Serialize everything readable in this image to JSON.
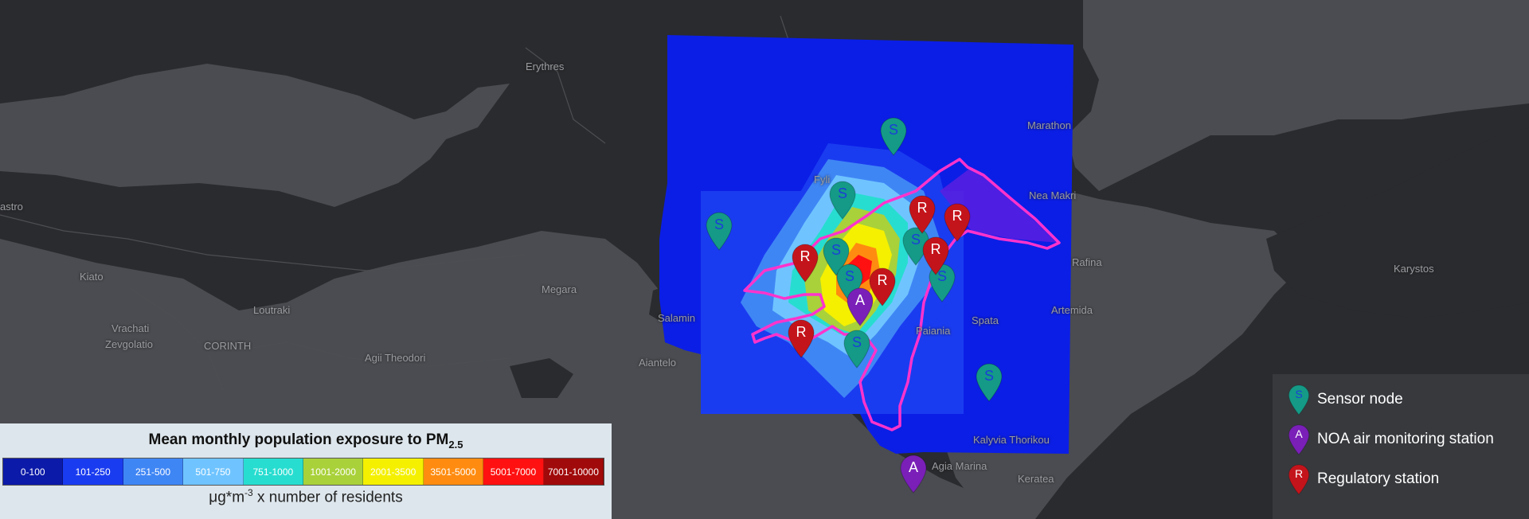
{
  "place_labels": [
    {
      "name": "Erythres"
    },
    {
      "name": "astro"
    },
    {
      "name": "Kiato"
    },
    {
      "name": "Loutraki"
    },
    {
      "name": "Vrachati"
    },
    {
      "name": "Zevgolatio"
    },
    {
      "name": "CORINTH"
    },
    {
      "name": "Agii Theodori"
    },
    {
      "name": "Megara"
    },
    {
      "name": "Fyli"
    },
    {
      "name": "Marathon"
    },
    {
      "name": "Nea Makri"
    },
    {
      "name": "Rafina"
    },
    {
      "name": "Karystos"
    },
    {
      "name": "Spata"
    },
    {
      "name": "Artemida"
    },
    {
      "name": "Paiania"
    },
    {
      "name": "Salamin"
    },
    {
      "name": "Aiantelo"
    },
    {
      "name": "Kalyvia Thorikou"
    },
    {
      "name": "Agia Marina"
    },
    {
      "name": "Keratea"
    }
  ],
  "markers": [
    {
      "type": "sensor",
      "letter": "S"
    },
    {
      "type": "sensor",
      "letter": "S"
    },
    {
      "type": "sensor",
      "letter": "S"
    },
    {
      "type": "sensor",
      "letter": "S"
    },
    {
      "type": "sensor",
      "letter": "S"
    },
    {
      "type": "sensor",
      "letter": "S"
    },
    {
      "type": "sensor",
      "letter": "S"
    },
    {
      "type": "sensor",
      "letter": "S"
    },
    {
      "type": "sensor",
      "letter": "S"
    },
    {
      "type": "regulatory",
      "letter": "R"
    },
    {
      "type": "regulatory",
      "letter": "R"
    },
    {
      "type": "regulatory",
      "letter": "R"
    },
    {
      "type": "regulatory",
      "letter": "R"
    },
    {
      "type": "regulatory",
      "letter": "R"
    },
    {
      "type": "regulatory",
      "letter": "R"
    },
    {
      "type": "noa",
      "letter": "A"
    },
    {
      "type": "noa",
      "letter": "A"
    }
  ],
  "colorbar": {
    "title": "Mean monthly population exposure to PM",
    "title_sub": "2.5",
    "unit_prefix": "μg*m",
    "unit_sup": "-3",
    "unit_suffix": " x number of residents",
    "bins": [
      {
        "label": "0-100",
        "color": "#0b1aa8",
        "text": "#ffffff"
      },
      {
        "label": "101-250",
        "color": "#1a3cf0",
        "text": "#ffffff"
      },
      {
        "label": "251-500",
        "color": "#3f86f5",
        "text": "#ffffff"
      },
      {
        "label": "501-750",
        "color": "#6fc4ff",
        "text": "#ffffff"
      },
      {
        "label": "751-1000",
        "color": "#27ddd0",
        "text": "#ffffff"
      },
      {
        "label": "1001-2000",
        "color": "#a9d13a",
        "text": "#ffffff"
      },
      {
        "label": "2001-3500",
        "color": "#f4f000",
        "text": "#ffffff"
      },
      {
        "label": "3501-5000",
        "color": "#ff8c10",
        "text": "#ffffff"
      },
      {
        "label": "5001-7000",
        "color": "#ff1111",
        "text": "#ffffff"
      },
      {
        "label": "7001-10000",
        "color": "#a10a0a",
        "text": "#ffffff"
      }
    ]
  },
  "legend": {
    "items": [
      {
        "type": "sensor",
        "letter": "S",
        "label": "Sensor node"
      },
      {
        "type": "noa",
        "letter": "A",
        "label": "NOA air monitoring station"
      },
      {
        "type": "regulatory",
        "letter": "R",
        "label": "Regulatory station"
      }
    ]
  },
  "colors": {
    "sensor": "#149a86",
    "sensor_letter": "#1b3fd6",
    "regulatory": "#c4141b",
    "regulatory_letter": "#ffffff",
    "noa": "#7a1fb8",
    "noa_letter": "#ffffff",
    "boundary": "#ff33cc",
    "land": "#2a2b2e",
    "sea": "#4a4c51"
  }
}
